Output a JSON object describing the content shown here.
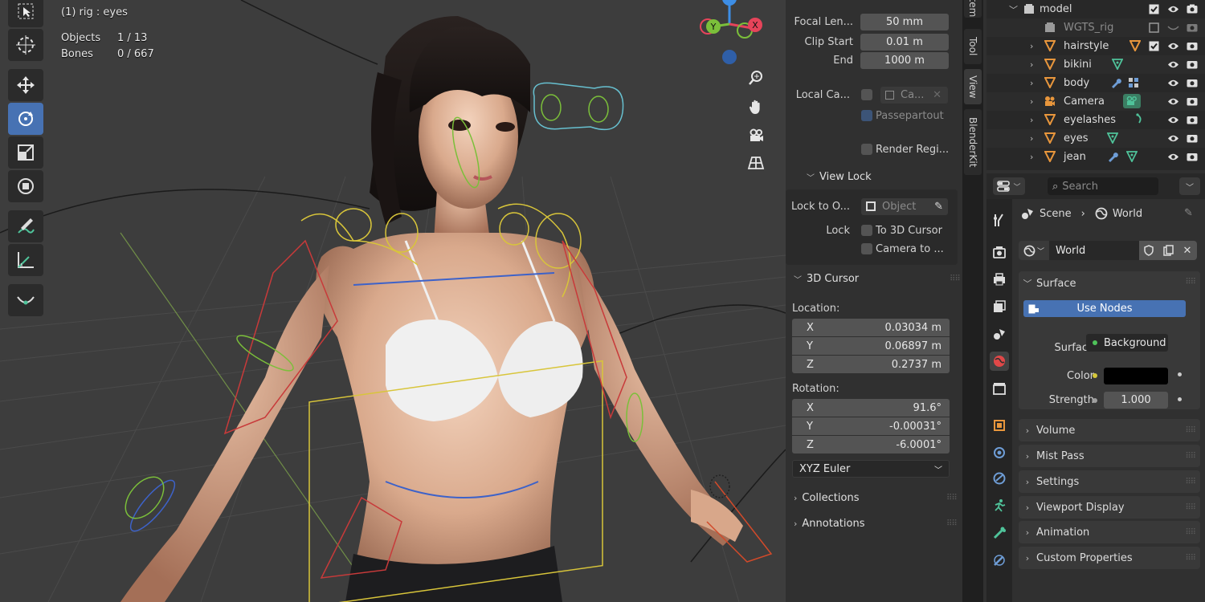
{
  "viewport": {
    "info": {
      "title": "(1) rig : eyes",
      "objects_label": "Objects",
      "objects_value": "1 / 13",
      "bones_label": "Bones",
      "bones_value": "0 / 667"
    },
    "gizmo": {
      "x": "X",
      "y": "Y"
    }
  },
  "npanel": {
    "focal_length_label": "Focal Len...",
    "focal_length_value": "50 mm",
    "clip_start_label": "Clip Start",
    "clip_start_value": "0.01 m",
    "clip_end_label": "End",
    "clip_end_value": "1000 m",
    "local_camera_label": "Local Ca...",
    "local_camera_value": "Ca...",
    "passepartout_label": "Passepartout",
    "render_region_label": "Render Regi...",
    "view_lock_header": "View Lock",
    "lock_to_object_label": "Lock to O...",
    "lock_to_object_placeholder": "Object",
    "lock_label": "Lock",
    "to_3d_cursor_label": "To 3D Cursor",
    "camera_to_view_label": "Camera to ...",
    "cursor_header": "3D Cursor",
    "location_label": "Location:",
    "location": [
      {
        "axis": "X",
        "value": "0.03034 m"
      },
      {
        "axis": "Y",
        "value": "0.06897 m"
      },
      {
        "axis": "Z",
        "value": "0.2737 m"
      }
    ],
    "rotation_label": "Rotation:",
    "rotation": [
      {
        "axis": "X",
        "value": "91.6°"
      },
      {
        "axis": "Y",
        "value": "-0.00031°"
      },
      {
        "axis": "Z",
        "value": "-6.0001°"
      }
    ],
    "rotation_mode": "XYZ Euler",
    "collections_label": "Collections",
    "annotations_label": "Annotations"
  },
  "vtabs": {
    "item": "Item",
    "tool": "Tool",
    "view": "View",
    "blenderkit": "BlenderKit"
  },
  "outliner": {
    "rows": [
      {
        "name": "model"
      },
      {
        "name": "WGTS_rig"
      },
      {
        "name": "hairstyle"
      },
      {
        "name": "bikini"
      },
      {
        "name": "body"
      },
      {
        "name": "Camera"
      },
      {
        "name": "eyelashes"
      },
      {
        "name": "eyes"
      },
      {
        "name": "jean"
      }
    ]
  },
  "properties": {
    "search_placeholder": "Search",
    "breadcrumb_scene": "Scene",
    "breadcrumb_world": "World",
    "world_name": "World",
    "surface_header": "Surface",
    "use_nodes_label": "Use Nodes",
    "surface_label": "Surface",
    "surface_value": "Background",
    "color_label": "Color",
    "strength_label": "Strength",
    "strength_value": "1.000",
    "sections": [
      "Volume",
      "Mist Pass",
      "Settings",
      "Viewport Display",
      "Animation",
      "Custom Properties"
    ]
  },
  "colors": {
    "accent": "#4772b3",
    "viewport_bg": "#3d3d3d",
    "panel_bg": "#303030",
    "mesh_icon": "#e8963c",
    "modifier_icon": "#6e9dd6",
    "shape_icon": "#4fc39a",
    "world_color": "#000000"
  }
}
